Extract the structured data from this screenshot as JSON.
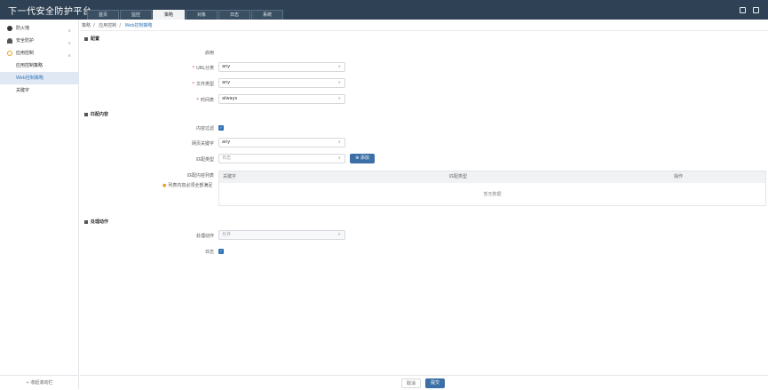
{
  "app": {
    "title": "下一代安全防护平台"
  },
  "tabs": [
    {
      "label": "首页"
    },
    {
      "label": "监控"
    },
    {
      "label": "策略"
    },
    {
      "label": "对象"
    },
    {
      "label": "日志"
    },
    {
      "label": "系统"
    }
  ],
  "active_tab": "策略",
  "topbar_icons": [
    "save-icon",
    "logout-icon"
  ],
  "sidebar": {
    "items": [
      {
        "label": "防火墙",
        "icon": "firewall-icon",
        "chevron": "∨"
      },
      {
        "label": "安全防护",
        "icon": "umbrella-icon",
        "chevron": "∨"
      },
      {
        "label": "应用控制",
        "icon": "app-control-icon",
        "chevron": "∧"
      },
      {
        "label": "应用控制策略"
      },
      {
        "label": "Web控制策略"
      },
      {
        "label": "关键字"
      }
    ],
    "collapse_label": "« 收起滚动栏"
  },
  "breadcrumb": [
    "策略",
    "应用控制",
    "Web控制策略"
  ],
  "sections": {
    "config": "配置",
    "match": "匹配内容",
    "action": "处理动作"
  },
  "form": {
    "enable_label": "启用",
    "url_label": "URL分类",
    "url_value": "any",
    "filetype_label": "文件类型",
    "filetype_value": "any",
    "schedule_label": "时间表",
    "schedule_value": "always",
    "content_filter_label": "内容过滤",
    "keyword_label": "网页关键字",
    "keyword_value": "any",
    "match_type_label": "匹配类型",
    "match_type_placeholder": "日志",
    "add_button": "添加",
    "list_label": "匹配内容列表",
    "hint": "列表内容必须全部满足",
    "table_headers": [
      "关键字",
      "匹配类型",
      "操作"
    ],
    "table_empty": "暂无数据",
    "action_label": "处理动作",
    "action_placeholder": "允许",
    "log_label": "日志"
  },
  "footer": {
    "cancel": "取消",
    "submit": "提交"
  },
  "colors": {
    "topbar": "#2f4154",
    "accent": "#3b6fa6",
    "required": "#e04040"
  }
}
